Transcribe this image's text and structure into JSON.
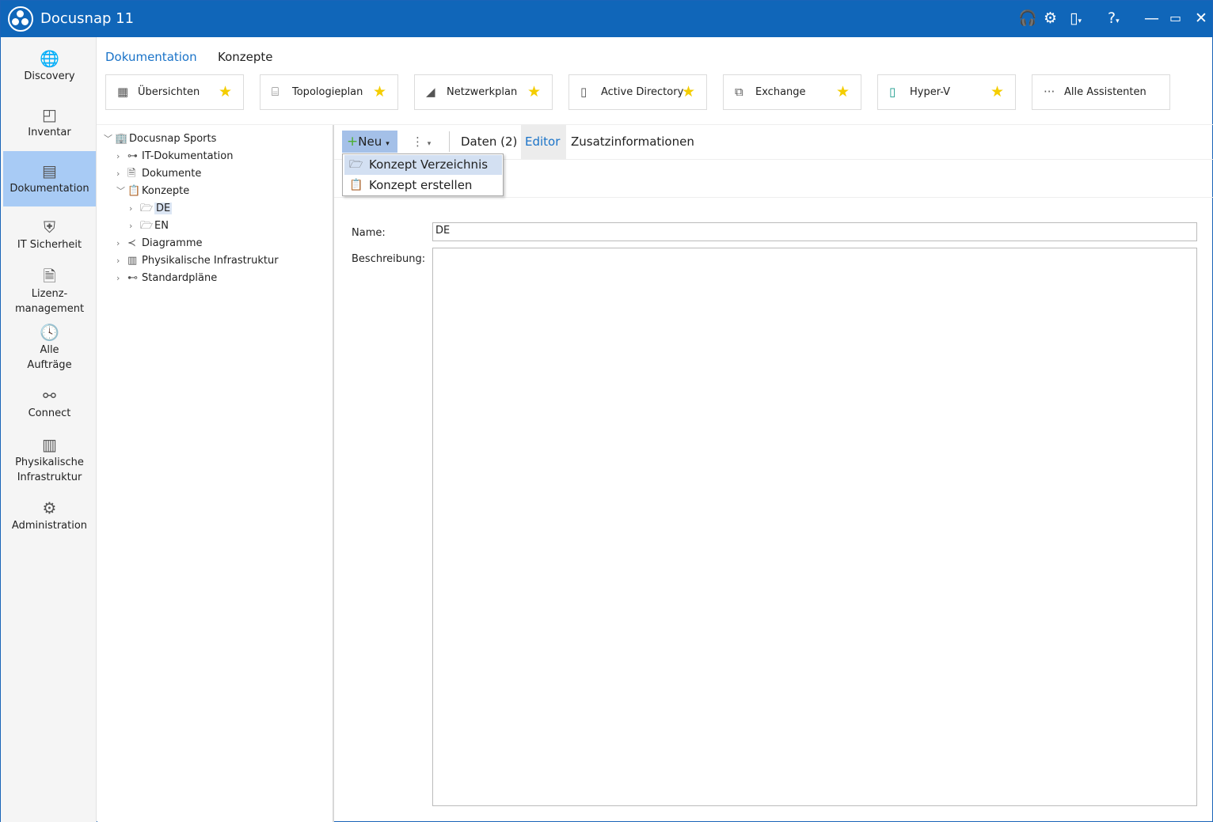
{
  "app": {
    "title": "Docusnap 11",
    "accent": "#1066b9"
  },
  "titlebar_icons": [
    "headset-icon",
    "gear-icon",
    "license-icon",
    "help-icon",
    "minimize-icon",
    "maximize-icon",
    "close-icon"
  ],
  "sidebar": {
    "items": [
      {
        "label": "Discovery",
        "icon": "globe-icon"
      },
      {
        "label": "Inventar",
        "icon": "inventory-icon"
      },
      {
        "label": "Dokumentation",
        "icon": "document-chart-icon",
        "selected": true
      },
      {
        "label": "IT Sicherheit",
        "icon": "shield-laptop-icon"
      },
      {
        "label": "Lizenz-\nmanagement",
        "icon": "license-doc-icon"
      },
      {
        "label": "Alle\nAufträge",
        "icon": "clock-icon"
      },
      {
        "label": "Connect",
        "icon": "plug-icon"
      },
      {
        "label": "Physikalische\nInfrastruktur",
        "icon": "server-icon"
      },
      {
        "label": "Administration",
        "icon": "gears-icon"
      }
    ]
  },
  "breadcrumb": {
    "root": "Dokumentation",
    "current": "Konzepte"
  },
  "assistants": [
    {
      "label": "Übersichten",
      "icon": "table-icon",
      "favorite": true
    },
    {
      "label": "Topologieplan",
      "icon": "topology-icon",
      "favorite": true
    },
    {
      "label": "Netzwerkplan",
      "icon": "network-icon",
      "favorite": true
    },
    {
      "label": "Active Directory",
      "icon": "ad-icon",
      "favorite": true
    },
    {
      "label": "Exchange",
      "icon": "exchange-icon",
      "favorite": true
    },
    {
      "label": "Hyper-V",
      "icon": "hyperv-icon",
      "favorite": true
    },
    {
      "label": "Alle Assistenten",
      "icon": "more-icon",
      "favorite": false
    }
  ],
  "tree": [
    {
      "label": "Docusnap Sports",
      "level": 0,
      "expanded": true
    },
    {
      "label": "IT-Dokumentation",
      "level": 1
    },
    {
      "label": "Dokumente",
      "level": 1
    },
    {
      "label": "Konzepte",
      "level": 1,
      "expanded": true
    },
    {
      "label": "DE",
      "level": 2,
      "selected": true
    },
    {
      "label": "EN",
      "level": 2
    },
    {
      "label": "Diagramme",
      "level": 1
    },
    {
      "label": "Physikalische Infrastruktur",
      "level": 1
    },
    {
      "label": "Standardpläne",
      "level": 1
    }
  ],
  "toolbar": {
    "new_label": "Neu",
    "tabs": [
      "Daten (2)",
      "Editor",
      "Zusatzinformationen"
    ],
    "active_tab": "Editor"
  },
  "new_menu": [
    "Konzept Verzeichnis",
    "Konzept erstellen"
  ],
  "form": {
    "name_label": "Name:",
    "name_value": "DE",
    "description_label": "Beschreibung:",
    "description_value": ""
  }
}
